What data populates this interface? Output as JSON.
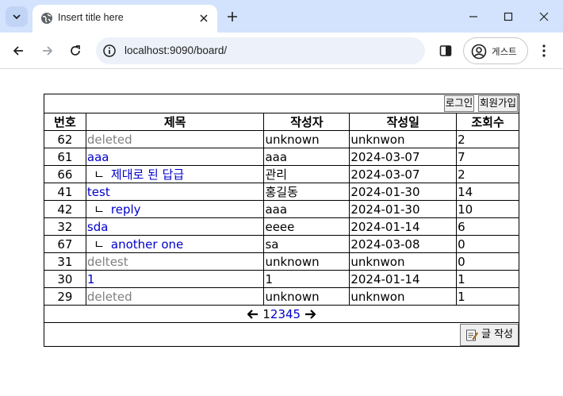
{
  "browser": {
    "tab_title": "Insert title here",
    "url": "localhost:9090/board/",
    "profile_label": "게스트"
  },
  "auth": {
    "login_label": "로그인",
    "signup_label": "회원가입"
  },
  "table": {
    "headers": [
      "번호",
      "제목",
      "작성자",
      "작성일",
      "조회수"
    ],
    "rows": [
      {
        "no": "62",
        "title": "deleted",
        "reply": false,
        "deleted": true,
        "writer": "unknown",
        "date": "unknwon",
        "views": "2"
      },
      {
        "no": "61",
        "title": "aaa",
        "reply": false,
        "deleted": false,
        "writer": "aaa",
        "date": "2024-03-07",
        "views": "7"
      },
      {
        "no": "66",
        "title": "제대로 된 답급",
        "reply": true,
        "deleted": false,
        "writer": "관리",
        "date": "2024-03-07",
        "views": "2"
      },
      {
        "no": "41",
        "title": "test",
        "reply": false,
        "deleted": false,
        "writer": "홍길동",
        "date": "2024-01-30",
        "views": "14"
      },
      {
        "no": "42",
        "title": "reply",
        "reply": true,
        "deleted": false,
        "writer": "aaa",
        "date": "2024-01-30",
        "views": "10"
      },
      {
        "no": "32",
        "title": "sda",
        "reply": false,
        "deleted": false,
        "writer": "eeee",
        "date": "2024-01-14",
        "views": "6"
      },
      {
        "no": "67",
        "title": "another one",
        "reply": true,
        "deleted": false,
        "writer": "sa",
        "date": "2024-03-08",
        "views": "0"
      },
      {
        "no": "31",
        "title": "deltest",
        "reply": false,
        "deleted": true,
        "writer": "unknown",
        "date": "unknwon",
        "views": "0"
      },
      {
        "no": "30",
        "title": "1",
        "reply": false,
        "deleted": false,
        "writer": "1",
        "date": "2024-01-14",
        "views": "1"
      },
      {
        "no": "29",
        "title": "deleted",
        "reply": false,
        "deleted": true,
        "writer": "unknown",
        "date": "unknwon",
        "views": "1"
      }
    ],
    "reply_marker": "ㄴ"
  },
  "pagination": {
    "prev": "🡐",
    "next": "🡒",
    "pages": [
      "1",
      "2",
      "3",
      "4",
      "5"
    ],
    "current": "1"
  },
  "write_button_label": "글 작성",
  "icons": {
    "tab_favicon": "globe-icon",
    "write": "memo-icon"
  }
}
